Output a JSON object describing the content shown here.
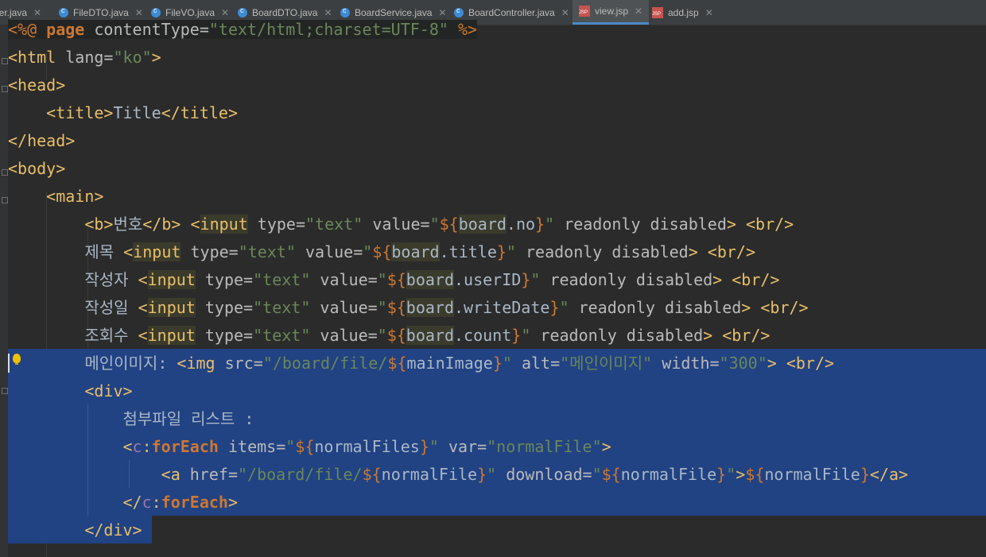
{
  "tabs": [
    {
      "label": "per.java",
      "type": "java"
    },
    {
      "label": "FileDTO.java",
      "type": "java"
    },
    {
      "label": "FileVO.java",
      "type": "java"
    },
    {
      "label": "BoardDTO.java",
      "type": "java"
    },
    {
      "label": "BoardService.java",
      "type": "java"
    },
    {
      "label": "BoardController.java",
      "type": "java"
    },
    {
      "label": "view.jsp",
      "type": "jsp",
      "active": true
    },
    {
      "label": "add.jsp",
      "type": "jsp"
    }
  ],
  "code_lines": [
    "<%@ page contentType=\"text/html;charset=UTF-8\" %>",
    "<html lang=\"ko\">",
    "<head>",
    "    <title>Title</title>",
    "</head>",
    "<body>",
    "    <main>",
    "        <b>번호</b> <input type=\"text\" value=\"${board.no}\" readonly disabled> <br/>",
    "        제목 <input type=\"text\" value=\"${board.title}\" readonly disabled> <br/>",
    "        작성자 <input type=\"text\" value=\"${board.userID}\" readonly disabled> <br/>",
    "        작성일 <input type=\"text\" value=\"${board.writeDate}\" readonly disabled> <br/>",
    "        조회수 <input type=\"text\" value=\"${board.count}\" readonly disabled> <br/>",
    "        메인이미지: <img src=\"/board/file/${mainImage}\" alt=\"메인이미지\" width=\"300\"> <br/>",
    "        <div>",
    "            첨부파일 리스트 :",
    "            <c:forEach items=\"${normalFiles}\" var=\"normalFile\">",
    "                <a href=\"/board/file/${normalFile}\" download=\"${normalFile}\">${normalFile}</a>",
    "            </c:forEach>",
    "        </div>"
  ],
  "colors": {
    "background": "#2b2b2b",
    "selection": "#214283",
    "tag": "#e8bf6a",
    "string": "#6a8759",
    "keyword": "#cc7832"
  }
}
